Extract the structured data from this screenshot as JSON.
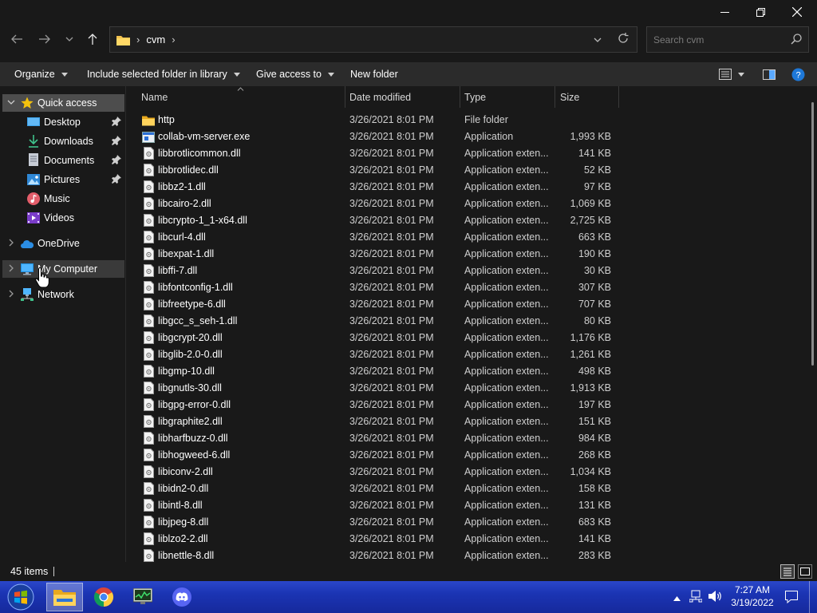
{
  "window": {
    "controls": [
      "minimize-icon",
      "restore-icon",
      "close-icon"
    ]
  },
  "address": {
    "crumbs": [
      "cvm"
    ]
  },
  "search": {
    "placeholder": "Search cvm"
  },
  "toolbar": {
    "organize": "Organize",
    "include_library": "Include selected folder in library",
    "give_access": "Give access to",
    "new_folder": "New folder"
  },
  "nav": {
    "quick_access": "Quick access",
    "pinned": [
      {
        "label": "Desktop",
        "icon": "desktop-icon",
        "pinned": true
      },
      {
        "label": "Downloads",
        "icon": "downloads-icon",
        "pinned": true
      },
      {
        "label": "Documents",
        "icon": "documents-icon",
        "pinned": true
      },
      {
        "label": "Pictures",
        "icon": "pictures-icon",
        "pinned": true
      },
      {
        "label": "Music",
        "icon": "music-icon",
        "pinned": false
      },
      {
        "label": "Videos",
        "icon": "videos-icon",
        "pinned": false
      }
    ],
    "onedrive": "OneDrive",
    "my_computer": "My Computer",
    "network": "Network"
  },
  "columns": {
    "name": "Name",
    "date": "Date modified",
    "type": "Type",
    "size": "Size"
  },
  "files": [
    {
      "name": "http",
      "date": "3/26/2021 8:01 PM",
      "type": "File folder",
      "size": "",
      "icon": "folder-icon"
    },
    {
      "name": "collab-vm-server.exe",
      "date": "3/26/2021 8:01 PM",
      "type": "Application",
      "size": "1,993 KB",
      "icon": "exe-icon"
    },
    {
      "name": "libbrotlicommon.dll",
      "date": "3/26/2021 8:01 PM",
      "type": "Application exten...",
      "size": "141 KB",
      "icon": "dll-icon"
    },
    {
      "name": "libbrotlidec.dll",
      "date": "3/26/2021 8:01 PM",
      "type": "Application exten...",
      "size": "52 KB",
      "icon": "dll-icon"
    },
    {
      "name": "libbz2-1.dll",
      "date": "3/26/2021 8:01 PM",
      "type": "Application exten...",
      "size": "97 KB",
      "icon": "dll-icon"
    },
    {
      "name": "libcairo-2.dll",
      "date": "3/26/2021 8:01 PM",
      "type": "Application exten...",
      "size": "1,069 KB",
      "icon": "dll-icon"
    },
    {
      "name": "libcrypto-1_1-x64.dll",
      "date": "3/26/2021 8:01 PM",
      "type": "Application exten...",
      "size": "2,725 KB",
      "icon": "dll-icon"
    },
    {
      "name": "libcurl-4.dll",
      "date": "3/26/2021 8:01 PM",
      "type": "Application exten...",
      "size": "663 KB",
      "icon": "dll-icon"
    },
    {
      "name": "libexpat-1.dll",
      "date": "3/26/2021 8:01 PM",
      "type": "Application exten...",
      "size": "190 KB",
      "icon": "dll-icon"
    },
    {
      "name": "libffi-7.dll",
      "date": "3/26/2021 8:01 PM",
      "type": "Application exten...",
      "size": "30 KB",
      "icon": "dll-icon"
    },
    {
      "name": "libfontconfig-1.dll",
      "date": "3/26/2021 8:01 PM",
      "type": "Application exten...",
      "size": "307 KB",
      "icon": "dll-icon"
    },
    {
      "name": "libfreetype-6.dll",
      "date": "3/26/2021 8:01 PM",
      "type": "Application exten...",
      "size": "707 KB",
      "icon": "dll-icon"
    },
    {
      "name": "libgcc_s_seh-1.dll",
      "date": "3/26/2021 8:01 PM",
      "type": "Application exten...",
      "size": "80 KB",
      "icon": "dll-icon"
    },
    {
      "name": "libgcrypt-20.dll",
      "date": "3/26/2021 8:01 PM",
      "type": "Application exten...",
      "size": "1,176 KB",
      "icon": "dll-icon"
    },
    {
      "name": "libglib-2.0-0.dll",
      "date": "3/26/2021 8:01 PM",
      "type": "Application exten...",
      "size": "1,261 KB",
      "icon": "dll-icon"
    },
    {
      "name": "libgmp-10.dll",
      "date": "3/26/2021 8:01 PM",
      "type": "Application exten...",
      "size": "498 KB",
      "icon": "dll-icon"
    },
    {
      "name": "libgnutls-30.dll",
      "date": "3/26/2021 8:01 PM",
      "type": "Application exten...",
      "size": "1,913 KB",
      "icon": "dll-icon"
    },
    {
      "name": "libgpg-error-0.dll",
      "date": "3/26/2021 8:01 PM",
      "type": "Application exten...",
      "size": "197 KB",
      "icon": "dll-icon"
    },
    {
      "name": "libgraphite2.dll",
      "date": "3/26/2021 8:01 PM",
      "type": "Application exten...",
      "size": "151 KB",
      "icon": "dll-icon"
    },
    {
      "name": "libharfbuzz-0.dll",
      "date": "3/26/2021 8:01 PM",
      "type": "Application exten...",
      "size": "984 KB",
      "icon": "dll-icon"
    },
    {
      "name": "libhogweed-6.dll",
      "date": "3/26/2021 8:01 PM",
      "type": "Application exten...",
      "size": "268 KB",
      "icon": "dll-icon"
    },
    {
      "name": "libiconv-2.dll",
      "date": "3/26/2021 8:01 PM",
      "type": "Application exten...",
      "size": "1,034 KB",
      "icon": "dll-icon"
    },
    {
      "name": "libidn2-0.dll",
      "date": "3/26/2021 8:01 PM",
      "type": "Application exten...",
      "size": "158 KB",
      "icon": "dll-icon"
    },
    {
      "name": "libintl-8.dll",
      "date": "3/26/2021 8:01 PM",
      "type": "Application exten...",
      "size": "131 KB",
      "icon": "dll-icon"
    },
    {
      "name": "libjpeg-8.dll",
      "date": "3/26/2021 8:01 PM",
      "type": "Application exten...",
      "size": "683 KB",
      "icon": "dll-icon"
    },
    {
      "name": "liblzo2-2.dll",
      "date": "3/26/2021 8:01 PM",
      "type": "Application exten...",
      "size": "141 KB",
      "icon": "dll-icon"
    },
    {
      "name": "libnettle-8.dll",
      "date": "3/26/2021 8:01 PM",
      "type": "Application exten...",
      "size": "283 KB",
      "icon": "dll-icon"
    }
  ],
  "status": {
    "item_count": "45 items"
  },
  "taskbar": {
    "apps": [
      "start-orb-icon",
      "file-explorer-icon",
      "chrome-icon",
      "task-manager-icon",
      "discord-icon"
    ],
    "time": "7:27 AM",
    "date": "3/19/2022"
  },
  "colors": {
    "background": "#191919",
    "command_bar": "#2b2b2b",
    "selected_nav": "#4d4d4d",
    "folder": "#f2c14e",
    "taskbar": "#1b34b3"
  }
}
